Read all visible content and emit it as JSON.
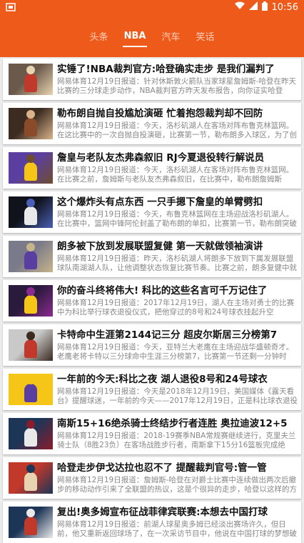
{
  "status": {
    "time": "10:56"
  },
  "tabs": [
    {
      "label": "头条",
      "active": false
    },
    {
      "label": "NBA",
      "active": true
    },
    {
      "label": "汽车",
      "active": false
    },
    {
      "label": "笑话",
      "active": false
    }
  ],
  "colors": {
    "accent": "#ee5a1a"
  },
  "news": [
    {
      "title": "实锤了!NBA裁判官方:哈登确实走步 是我们漏判了",
      "desc": "网易体育12月19日报道：针对休斯敦火箭队当家球星詹姆斯-哈登在昨天比赛的三分球走步动作，NBA裁判官方昨天发布报告，向你证实哈登",
      "thumb": [
        "#6b5a4b",
        "#c0392b",
        "#e8d3b0"
      ]
    },
    {
      "title": "勒布朗自抛自投尴尬演砸 忙着抱怨裁判却不回防",
      "desc": "网易体育12月19日报道：今天，洛杉矶湖人在客场对阵布鲁克林篮网。在这比赛中的一次自抛自投演砸，比赛第一节，勒布朗多入球区，为了创造",
      "thumb": [
        "#3b2b20",
        "#8a4b2a",
        "#d9b38c"
      ]
    },
    {
      "title": "詹皇与老队友杰弗森叙旧 RJ今夏退役转行解说员",
      "desc": "网易体育12月19日报道：今天，洛杉矶湖人在客场对阵布鲁克林篮网。在比赛之前，詹姆斯与老队友杰弗森叙旧，在比赛中，勒布朗詹姆斯",
      "thumb": [
        "#5b3fa0",
        "#f5c518",
        "#6e4d2f"
      ]
    },
    {
      "title": "这个爆炸头有点东西 一只手摁下詹皇的单臂劈扣",
      "desc": "网易体育12月19日报道：今天，布鲁克林篮网在主场迎战洛杉矶湖人。在比赛中，篮网中锋阿伦封盖了勒布朗的单扣，比赛第一节，勒布朗突破内线",
      "thumb": [
        "#10131b",
        "#e9e9e9",
        "#4a5fb3"
      ]
    },
    {
      "title": "朗多被下放到发展联盟复健 第一天就做领袖演讲",
      "desc": "网易体育12月19日报道：昨天，洛杉矶湖人将朗多下放到下属发展联盟球队南湖湖人队，让他调整状态恢复比赛节奏。比赛之前，朗多复健中就被",
      "thumb": [
        "#7a7a8a",
        "#5b3fa0",
        "#c8b48a"
      ]
    },
    {
      "title": "你的奋斗终将伟大! 科比的这些名言可千万记住了",
      "desc": "网易体育12月19日报道：2017年12月19日，湖人在主场对勇士的比赛中为科比举行球衣退役仪式，把他穿过的8号和24号球衣挂起升空",
      "thumb": [
        "#2a1a3b",
        "#f5c518",
        "#8a2b8f"
      ]
    },
    {
      "title": "卡特命中生涯第2144记三分 超皮尔斯居三分榜第7",
      "desc": "网易体育12月19日报道：今天，亚特兰大老鹰在主场迎战华盛顿奇才。老鹰老将卡特以三分球命中生涯三分榜第7，比赛第一节还剩一分钟时",
      "thumb": [
        "#c9c9c9",
        "#c0392b",
        "#3b2b20"
      ]
    },
    {
      "title": "一年前的今天:科比之夜 湖人退役8号和24号球衣",
      "desc": "网易体育12月19日报道：今天是2018年12月19日，美国媒体《露天看台》提醒球迷，一年前的今天——2017年12月19日，正是科比球衣退役的日子",
      "thumb": [
        "#f5c518",
        "#5b3fa0",
        "#f5c518"
      ]
    },
    {
      "title": "南斯15+16绝杀骑士终结步行者连胜 奥拉迪波12+5",
      "desc": "网易体育12月19日报道：2018-19赛季NBA常规赛继续进行，克里夫兰骑士队（8胜23负）在客场战胜步行者，南斯拿下15分16篮板完成绝杀，终结",
      "thumb": [
        "#1d3557",
        "#e9e9e9",
        "#8a1c2b"
      ]
    },
    {
      "title": "哈登走步伊戈达拉也忍不了 提醒裁判官号:管一管",
      "desc": "网易体育12月19日报道：詹姆斯-哈登在对爵士比赛中连续做出两次后撤步的移动动作引来了全联盟的热议，这是个很异的走步，哈登以这样的方式终",
      "thumb": [
        "#c0392b",
        "#e8d3b0",
        "#1d3557"
      ]
    },
    {
      "title": "复出!奥多姆宣布征战菲律宾联赛:本想去中国打球",
      "desc": "网易体育12月19日报道：前湖人球星奥多姆已经淡出赛场许久，但日前，他又重新返回球场了，在一次采访节目中，他说在中国打球的梦想破灭了",
      "thumb": [
        "#1d3557",
        "#c0392b",
        "#e9e9e9"
      ]
    }
  ]
}
